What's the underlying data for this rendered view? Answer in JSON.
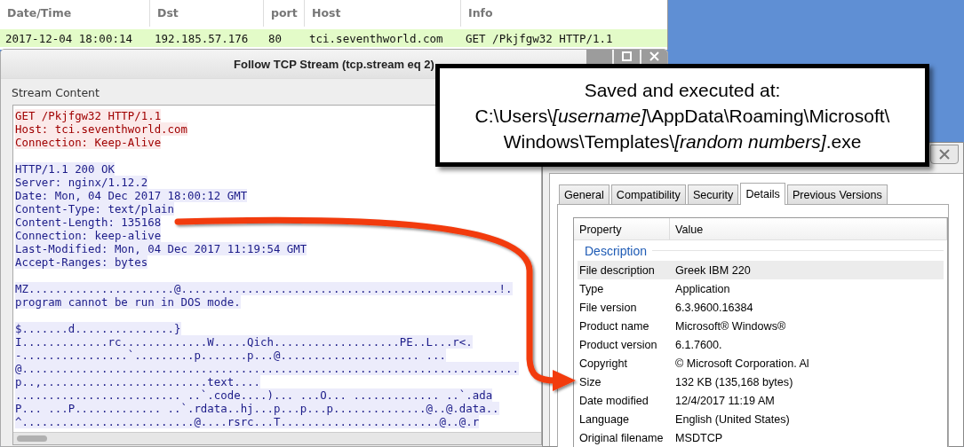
{
  "packet_list": {
    "columns": [
      "Date/Time",
      "Dst",
      "port",
      "Host",
      "Info"
    ],
    "rows": [
      {
        "cells": [
          "2017-12-04 18:00:14",
          "192.185.57.176",
          "80",
          "tci.seventhworld.com",
          "GET /Pkjfgw32 HTTP/1.1"
        ],
        "selected": true
      }
    ]
  },
  "stream_dialog": {
    "title": "Follow TCP Stream (tcp.stream eq 2)",
    "section_label": "Stream Content",
    "lines": [
      {
        "kind": "client",
        "text": "GET /Pkjfgw32 HTTP/1.1"
      },
      {
        "kind": "client",
        "text": "Host: tci.seventhworld.com"
      },
      {
        "kind": "client",
        "text": "Connection: Keep-Alive"
      },
      {
        "kind": "blank"
      },
      {
        "kind": "server",
        "text": "HTTP/1.1 200 OK"
      },
      {
        "kind": "server",
        "text": "Server: nginx/1.12.2"
      },
      {
        "kind": "server",
        "text": "Date: Mon, 04 Dec 2017 18:00:12 GMT"
      },
      {
        "kind": "server",
        "text": "Content-Type: text/plain"
      },
      {
        "kind": "server",
        "text": "Content-Length: 135168"
      },
      {
        "kind": "server",
        "text": "Connection: keep-alive"
      },
      {
        "kind": "server",
        "text": "Last-Modified: Mon, 04 Dec 2017 11:19:54 GMT"
      },
      {
        "kind": "server",
        "text": "Accept-Ranges: bytes"
      },
      {
        "kind": "blank"
      },
      {
        "kind": "server",
        "text": "MZ......................@................................................!."
      },
      {
        "kind": "server",
        "text": "program cannot be run in DOS mode."
      },
      {
        "kind": "blank"
      },
      {
        "kind": "server",
        "text": "$.......d...............}"
      },
      {
        "kind": "server",
        "text": "I.............rc.............W.....Qich...................PE..L...r<."
      },
      {
        "kind": "server",
        "text": "-................`.........p.......p...@..................... ..."
      },
      {
        "kind": "server",
        "text": "@..........................................................................."
      },
      {
        "kind": "server",
        "text": "p..,.........................text...."
      },
      {
        "kind": "server",
        "text": "......................... ..`.code....)... ...O... ............. ..`.ada"
      },
      {
        "kind": "server",
        "text": "P... ...P............. ..`.rdata..hj...p...p...p..............@..@.data.."
      },
      {
        "kind": "server",
        "text": "^..........................@....rsrc...T........................@..@.r"
      }
    ]
  },
  "properties_window": {
    "tabs": [
      {
        "label": "General",
        "selected": false
      },
      {
        "label": "Compatibility",
        "selected": false
      },
      {
        "label": "Security",
        "selected": false
      },
      {
        "label": "Details",
        "selected": true
      },
      {
        "label": "Previous Versions",
        "selected": false
      }
    ],
    "columns": [
      "Property",
      "Value"
    ],
    "group": "Description",
    "rows": [
      {
        "property": "File description",
        "value": "Greek IBM 220",
        "selected": true
      },
      {
        "property": "Type",
        "value": "Application",
        "selected": false
      },
      {
        "property": "File version",
        "value": "6.3.9600.16384",
        "selected": false
      },
      {
        "property": "Product name",
        "value": "Microsoft® Windows®",
        "selected": false
      },
      {
        "property": "Product version",
        "value": "6.1.7600.",
        "selected": false
      },
      {
        "property": "Copyright",
        "value": "© Microsoft Corporation. Al",
        "selected": false
      },
      {
        "property": "Size",
        "value": "132 KB (135,168 bytes)",
        "selected": false
      },
      {
        "property": "Date modified",
        "value": "12/4/2017 11:19 AM",
        "selected": false
      },
      {
        "property": "Language",
        "value": "English (United States)",
        "selected": false
      },
      {
        "property": "Original filename",
        "value": "MSDTCP",
        "selected": false
      }
    ]
  },
  "callout": {
    "lines": [
      "Saved and executed at:",
      "C:\\Users\\*[username]*\\AppData\\Roaming\\Microsoft\\",
      "Windows\\Templates\\*[random numbers]*.exe"
    ]
  }
}
